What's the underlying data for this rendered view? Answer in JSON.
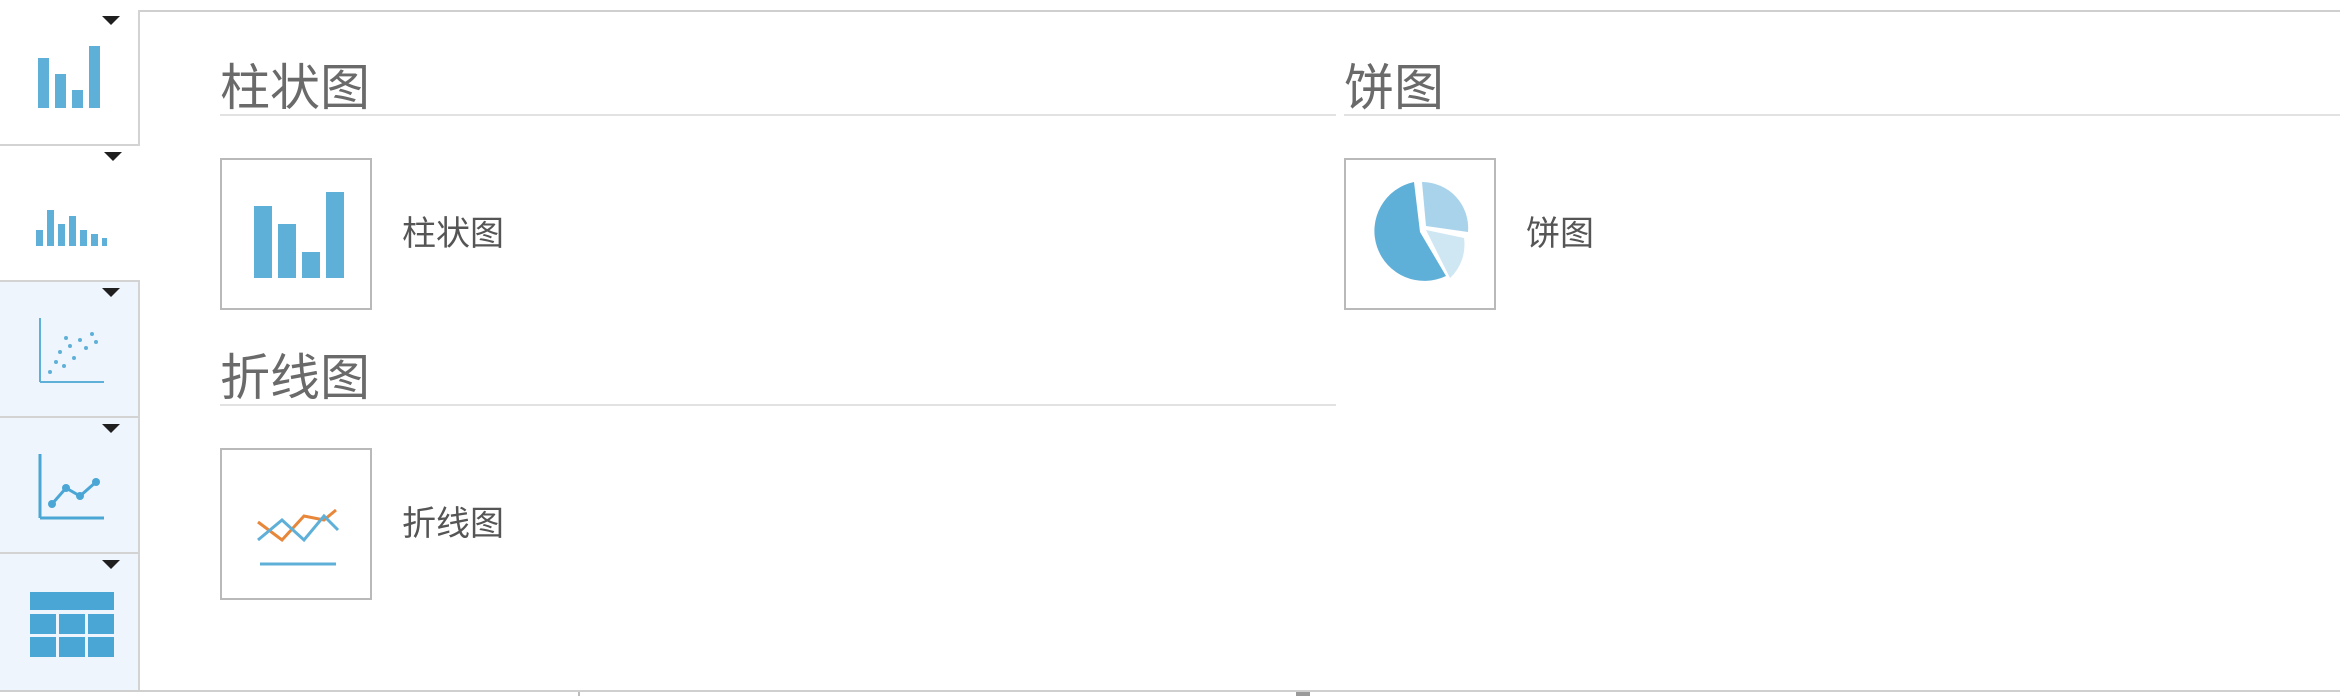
{
  "sidebar": {
    "tabs": [
      {
        "icon": "bar-chart-icon"
      },
      {
        "icon": "histogram-icon"
      },
      {
        "icon": "scatter-plot-icon"
      },
      {
        "icon": "line-chart-icon"
      },
      {
        "icon": "table-icon"
      }
    ]
  },
  "sections": {
    "bar": {
      "title": "柱状图",
      "options": [
        {
          "label": "柱状图",
          "icon": "bar-chart-icon"
        }
      ]
    },
    "pie": {
      "title": "饼图",
      "options": [
        {
          "label": "饼图",
          "icon": "pie-chart-icon"
        }
      ]
    },
    "line": {
      "title": "折线图",
      "options": [
        {
          "label": "折线图",
          "icon": "line-chart-icon"
        }
      ]
    }
  },
  "colors": {
    "accent": "#5fb0d8",
    "accent_light": "#a9d3ea",
    "accent_lighter": "#cfe6f3",
    "line_orange": "#e8863a",
    "tab_bg": "#eef5fc"
  }
}
